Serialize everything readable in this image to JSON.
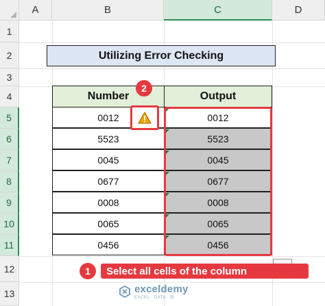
{
  "columns": [
    "A",
    "B",
    "C",
    "D"
  ],
  "selected_column": "C",
  "rows": [
    "1",
    "2",
    "3",
    "4",
    "5",
    "6",
    "7",
    "8",
    "9",
    "10",
    "11",
    "12",
    "13"
  ],
  "selected_rows": [
    "5",
    "6",
    "7",
    "8",
    "9",
    "10",
    "11"
  ],
  "title": "Utilizing Error Checking",
  "table": {
    "headers": [
      "Number",
      "Output"
    ],
    "number": [
      "0012",
      "5523",
      "0045",
      "0677",
      "0008",
      "0065",
      "0456"
    ],
    "output": [
      "0012",
      "5523",
      "0045",
      "0677",
      "0008",
      "0065",
      "0456"
    ]
  },
  "annotations": {
    "step1_number": "1",
    "step1_text": "Select all cells of the column",
    "step2_number": "2"
  },
  "icons": {
    "error_smart_tag": "warning-triangle-icon",
    "watermark": "exceldemy-logo-icon"
  },
  "watermark": {
    "name": "exceldemy",
    "tagline": "EXCEL · DATA · BI"
  },
  "colors": {
    "highlight": "#e5393f",
    "selection_fill": "#c8c8c8",
    "header_fill": "#e2efd9",
    "title_fill": "#dde6f4",
    "warning": "#f0a400"
  }
}
